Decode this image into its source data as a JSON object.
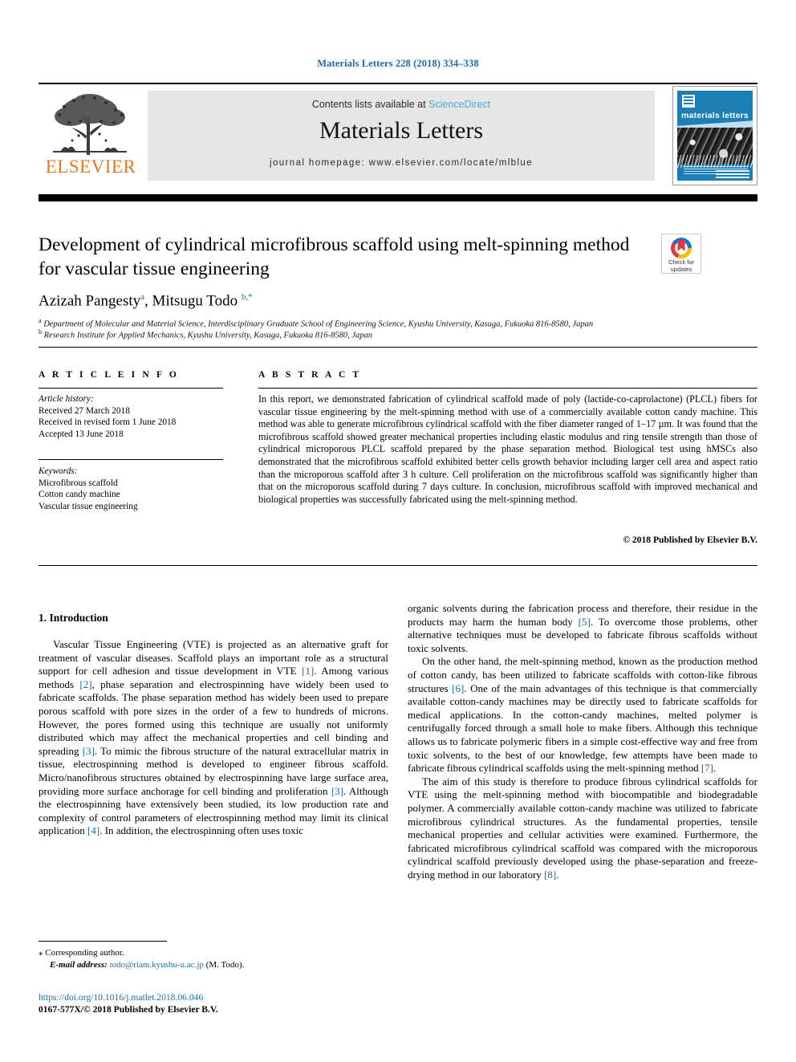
{
  "running_head": "Materials Letters 228 (2018) 334–338",
  "masthead": {
    "publisher_name": "ELSEVIER",
    "contents_prefix": "Contents lists available at ",
    "contents_link": "ScienceDirect",
    "journal_title": "Materials Letters",
    "homepage": "journal homepage: www.elsevier.com/locate/mlblue",
    "cover_title": "materials letters"
  },
  "article": {
    "title": "Development of cylindrical microfibrous scaffold using melt-spinning method for vascular tissue engineering",
    "crossmark_line1": "Check for",
    "crossmark_line2": "updates",
    "authors_html": "Azizah Pangesty<sup>a</sup>, Mitsugu Todo <sup>b,*</sup>",
    "affiliation_a": "Department of Molecular and Material Science, Interdisciplinary Graduate School of Engineering Science, Kyushu University, Kasuga, Fukuoka 816-8580, Japan",
    "affiliation_b": "Research Institute for Applied Mechanics, Kyushu University, Kasuga, Fukuoka 816-8580, Japan"
  },
  "article_info": {
    "heading": "A R T I C L E  I N F O",
    "history_label": "Article history:",
    "history": [
      "Received 27 March 2018",
      "Received in revised form 1 June 2018",
      "Accepted 13 June 2018"
    ],
    "keywords_label": "Keywords:",
    "keywords": [
      "Microfibrous scaffold",
      "Cotton candy machine",
      "Vascular tissue engineering"
    ]
  },
  "abstract": {
    "heading": "A B S T R A C T",
    "text": "In this report, we demonstrated fabrication of cylindrical scaffold made of poly (lactide-co-caprolactone) (PLCL) fibers for vascular tissue engineering by the melt-spinning method with use of a commercially available cotton candy machine. This method was able to generate microfibrous cylindrical scaffold with the fiber diameter ranged of 1–17 µm. It was found that the microfibrous scaffold showed greater mechanical properties including elastic modulus and ring tensile strength than those of cylindrical microporous PLCL scaffold prepared by the phase separation method. Biological test using hMSCs also demonstrated that the microfibrous scaffold exhibited better cells growth behavior including larger cell area and aspect ratio than the microporous scaffold after 3 h culture. Cell proliferation on the microfibrous scaffold was significantly higher than that on the microporous scaffold during 7 days culture. In conclusion, microfibrous scaffold with improved mechanical and biological properties was successfully fabricated using the melt-spinning method.",
    "copyright": "© 2018 Published by Elsevier B.V."
  },
  "body": {
    "section_heading": "1. Introduction",
    "left_paragraphs": [
      "Vascular Tissue Engineering (VTE) is projected as an alternative graft for treatment of vascular diseases. Scaffold plays an important role as a structural support for cell adhesion and tissue development in VTE [1]. Among various methods [2], phase separation and electrospinning have widely been used to fabricate scaffolds. The phase separation method has widely been used to prepare porous scaffold with pore sizes in the order of a few to hundreds of microns. However, the pores formed using this technique are usually not uniformly distributed which may affect the mechanical properties and cell binding and spreading [3]. To mimic the fibrous structure of the natural extracellular matrix in tissue, electrospinning method is developed to engineer fibrous scaffold. Micro/nanofibrous structures obtained by electrospinning have large surface area, providing more surface anchorage for cell binding and proliferation [3]. Although the electrospinning have extensively been studied, its low production rate and complexity of control parameters of electrospinning method may limit its clinical application [4]. In addition, the electrospinning often uses toxic"
    ],
    "right_paragraphs": [
      "organic solvents during the fabrication process and therefore, their residue in the products may harm the human body [5]. To overcome those problems, other alternative techniques must be developed to fabricate fibrous scaffolds without toxic solvents.",
      "On the other hand, the melt-spinning method, known as the production method of cotton candy, has been utilized to fabricate scaffolds with cotton-like fibrous structures [6]. One of the main advantages of this technique is that commercially available cotton-candy machines may be directly used to fabricate scaffolds for medical applications. In the cotton-candy machines, melted polymer is centrifugally forced through a small hole to make fibers. Although this technique allows us to fabricate polymeric fibers in a simple cost-effective way and free from toxic solvents, to the best of our knowledge, few attempts have been made to fabricate fibrous cylindrical scaffolds using the melt-spinning method [7].",
      "The aim of this study is therefore to produce fibrous cylindrical scaffolds for VTE using the melt-spinning method with biocompatible and biodegradable polymer. A commercially available cotton-candy machine was utilized to fabricate microfibrous cylindrical structures. As the fundamental properties, tensile mechanical properties and cellular activities were examined. Furthermore, the fabricated microfibrous cylindrical scaffold was compared with the microporous cylindrical scaffold previously developed using the phase-separation and freeze-drying method in our laboratory [8]."
    ]
  },
  "footer": {
    "corresponding_marker": "⁎",
    "corresponding_label": "Corresponding author.",
    "email_label": "E-mail address:",
    "email": "todo@riam.kyushu-u.ac.jp",
    "email_suffix": "(M. Todo).",
    "doi": "https://doi.org/10.1016/j.matlet.2018.06.046",
    "issn_line": "0167-577X/© 2018 Published by Elsevier B.V."
  },
  "colors": {
    "link_blue": "#1b6ca8",
    "sciencedirect_blue": "#4da6dd",
    "elsevier_orange": "#E87722",
    "cover_blue": "#1b7fb5"
  }
}
